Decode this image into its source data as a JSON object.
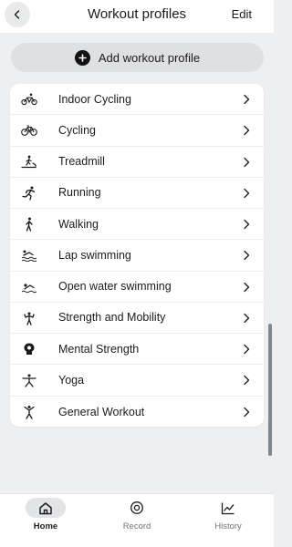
{
  "header": {
    "title": "Workout profiles",
    "edit_label": "Edit"
  },
  "add_button": {
    "label": "Add workout profile"
  },
  "profiles": [
    {
      "label": "Indoor Cycling",
      "icon": "indoor-cycling-icon"
    },
    {
      "label": "Cycling",
      "icon": "bicycle-icon"
    },
    {
      "label": "Treadmill",
      "icon": "treadmill-icon"
    },
    {
      "label": "Running",
      "icon": "running-icon"
    },
    {
      "label": "Walking",
      "icon": "walking-icon"
    },
    {
      "label": "Lap swimming",
      "icon": "lap-swimming-icon"
    },
    {
      "label": "Open water swimming",
      "icon": "open-water-swimming-icon"
    },
    {
      "label": "Strength and Mobility",
      "icon": "strength-icon"
    },
    {
      "label": "Mental Strength",
      "icon": "mental-strength-icon"
    },
    {
      "label": "Yoga",
      "icon": "yoga-icon"
    },
    {
      "label": "General Workout",
      "icon": "general-workout-icon"
    }
  ],
  "nav": {
    "home": "Home",
    "record": "Record",
    "history": "History",
    "active": "home"
  },
  "colors": {
    "background": "#eeeff1",
    "card": "#ffffff",
    "text": "#1b1b1b",
    "muted": "#6f7378",
    "pill": "#dfe0e3"
  }
}
